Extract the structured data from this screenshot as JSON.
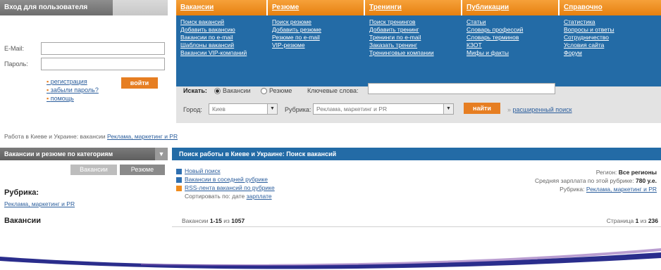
{
  "login": {
    "title": "Вход для пользователя",
    "email_label": "E-Mail:",
    "password_label": "Пароль:",
    "links": [
      "регистрация",
      "забыли пароль?",
      "помощь"
    ],
    "submit_label": "войти"
  },
  "nav": [
    {
      "tab": "Вакансии",
      "links": [
        "Поиск вакансий",
        "Добавить вакансию",
        "Вакансии по e-mail",
        "Шаблоны вакансий",
        "Вакансии VIP-компаний"
      ]
    },
    {
      "tab": "Резюме",
      "links": [
        "Поиск резюме",
        "Добавить резюме",
        "Резюме по e-mail",
        "VIP-резюме"
      ]
    },
    {
      "tab": "Тренинги",
      "links": [
        "Поиск тренингов",
        "Добавить тренинг",
        "Тренинги по e-mail",
        "Заказать тренинг",
        "Тренинговые компании"
      ]
    },
    {
      "tab": "Публикации",
      "links": [
        "Статьи",
        "Словарь профессий",
        "Словарь терминов",
        "КЗОТ",
        "Мифы и факты"
      ]
    },
    {
      "tab": "Справочно",
      "links": [
        "Статистика",
        "Вопросы и ответы",
        "Сотрудничество",
        "Условия сайта",
        "Форум"
      ]
    }
  ],
  "search": {
    "search_label": "Искать:",
    "radio_vacancies": "Вакансии",
    "radio_resume": "Резюме",
    "keywords_label": "Ключевые слова:",
    "keywords_value": "",
    "city_label": "Город:",
    "city_value": "Киев",
    "rubric_label": "Рубрика:",
    "rubric_value": "Реклама, маркетинг и PR",
    "find_label": "найти",
    "advanced_link": "расширенный поиск"
  },
  "breadcrumb": {
    "prefix": "Работа в Киеве и Украине: вакансии",
    "link": "Реклама, маркетинг и PR"
  },
  "sidebar": {
    "category_title": "Вакансии и резюме по категориям",
    "tab_vacancies": "Вакансии",
    "tab_resume": "Резюме",
    "rubric_heading": "Рубрика:",
    "rubric_link": "Реклама, маркетинг и PR",
    "vacancies_heading": "Вакансии"
  },
  "main": {
    "header": "Поиск работы в Киеве и Украине: Поиск вакансий",
    "options": [
      "Новый поиск",
      "Вакансии в соседней рубрике",
      "RSS-лента вакансий по рубрике"
    ],
    "sort_label": "Сортировать по:",
    "sort_value": "дате",
    "sort_link": "зарплате",
    "region_label": "Регион:",
    "region_value": "Все регионы",
    "salary_label": "Средняя зарплата по этой рубрике:",
    "salary_value": "780 у.е.",
    "rubric_label": "Рубрика:",
    "rubric_value": "Реклама, маркетинг и PR",
    "found_prefix": "Вакансии",
    "found_range": "1-15",
    "found_of": "из",
    "found_total": "1057",
    "pages_prefix": "Страница",
    "pages_current": "1",
    "pages_of": "из",
    "pages_total": "236"
  },
  "colors": {
    "nav_blue": "#236ba6",
    "accent_orange": "#e67e22",
    "swoosh": "#2a2d8c"
  }
}
